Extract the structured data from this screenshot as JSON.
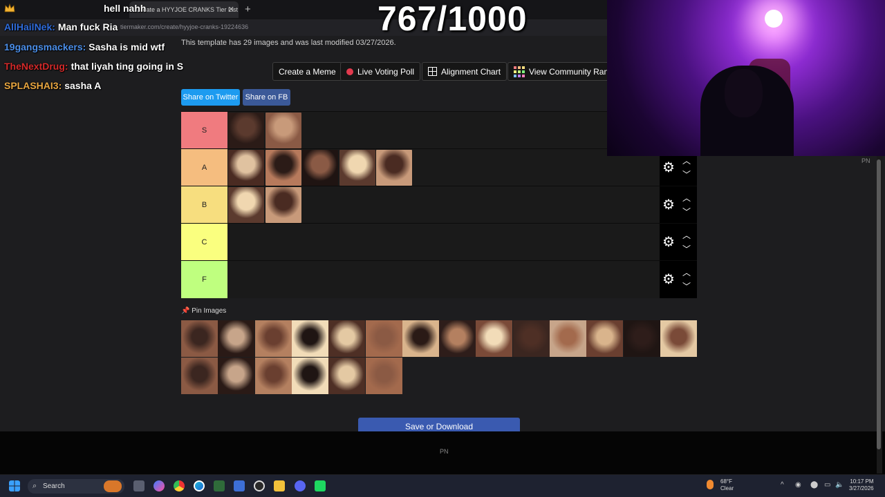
{
  "browser": {
    "tab_title": "Create a HYYJOE CRANKS Tier List",
    "tab_close": "✕",
    "new_tab": "+",
    "url": "tiermaker.com/create/hyyjoe-cranks-19224636"
  },
  "chat": [
    {
      "user": "",
      "message": "hell nahh",
      "color": "#7aa2ff"
    },
    {
      "user": "AllHailNek:",
      "message": "Man fuck Ria",
      "color": "#2f6cdb"
    },
    {
      "user": "19gangsmackers:",
      "message": "Sasha is mid wtf",
      "color": "#4b8ee8"
    },
    {
      "user": "TheNextDrug:",
      "message": "that liyah ting going in S",
      "color": "#d42a2a"
    },
    {
      "user": "SPLASHAI3:",
      "message": "sasha A",
      "color": "#e8a640"
    }
  ],
  "counter": "767/1000",
  "page": {
    "template_info": "This template has 29 images and was last modified 03/27/2026.",
    "buttons": {
      "create_meme": "Create a Meme",
      "live_poll": "Live Voting Poll",
      "alignment": "Alignment Chart",
      "community": "View Community Rank"
    },
    "share_twitter": "Share on Twitter",
    "share_fb": "Share on FB",
    "tiers": [
      {
        "label": "S",
        "color": "#f07b7f",
        "count": 2
      },
      {
        "label": "A",
        "color": "#f5bd7f",
        "count": 5
      },
      {
        "label": "B",
        "color": "#f7de7f",
        "count": 2
      },
      {
        "label": "C",
        "color": "#faff7f",
        "count": 0
      },
      {
        "label": "F",
        "color": "#bfff7f",
        "count": 0
      }
    ],
    "tier_controls": {
      "gear": "⚙",
      "up": "︿",
      "down": "﹀"
    },
    "pin_images": "Pin Images",
    "pin_icon": "📌",
    "pool_count": 20,
    "save": "Save or Download",
    "pn_footer": "PN",
    "pn_side": "PN"
  },
  "taskbar": {
    "search": "Search",
    "weather_temp": "68°F",
    "weather_desc": "Clear",
    "time": "10:17 PM",
    "date": "3/27/2026"
  }
}
